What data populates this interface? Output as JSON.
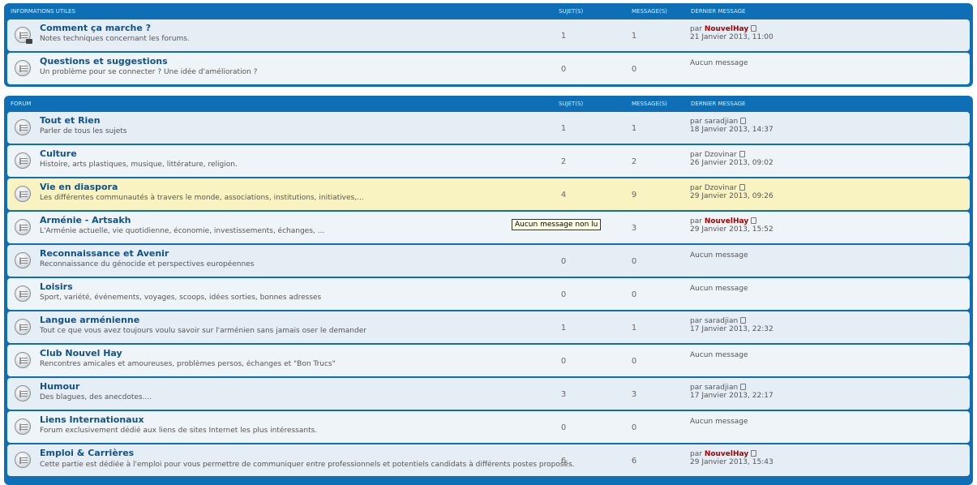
{
  "sections": [
    {
      "header": {
        "name": "INFORMATIONS UTILES",
        "topics": "SUJET(S)",
        "posts": "MESSAGE(S)",
        "last": "DERNIER MESSAGE"
      },
      "forums": [
        {
          "title": "Comment ça marche ?",
          "desc": "Notes techniques concernant les forums.",
          "topics": "1",
          "posts": "1",
          "by_prefix": "par",
          "author": "NouvelHay",
          "date": "21 Janvier 2013, 11:00",
          "icon": "forum-read-locked-icon"
        },
        {
          "title": "Questions et suggestions",
          "desc": "Un problème pour se connecter ? Une idée d'amélioration ?",
          "topics": "0",
          "posts": "0",
          "none": "Aucun message",
          "icon": "forum-read-icon"
        }
      ]
    },
    {
      "header": {
        "name": "FORUM",
        "topics": "SUJET(S)",
        "posts": "MESSAGE(S)",
        "last": "DERNIER MESSAGE"
      },
      "forums": [
        {
          "title": "Tout et Rien",
          "desc": "Parler de tous les sujets",
          "topics": "1",
          "posts": "1",
          "by_prefix": "par",
          "author": "saradjian",
          "date": "18 Janvier 2013, 14:37"
        },
        {
          "title": "Culture",
          "desc": "Histoire, arts plastiques, musique, littérature, religion.",
          "topics": "2",
          "posts": "2",
          "by_prefix": "par",
          "author": "Dzovinar",
          "date": "26 Janvier 2013, 09:02"
        },
        {
          "title": "Vie en diaspora",
          "desc": "Les différentes communautés à travers le monde, associations, institutions, initiatives,...",
          "topics": "4",
          "posts": "9",
          "by_prefix": "par",
          "author": "Dzovinar",
          "date": "29 Janvier 2013, 09:26"
        },
        {
          "title": "Arménie - Artsakh",
          "desc": "L'Arménie actuelle, vie quotidienne, économie, investissements, échanges, ...",
          "topics": "",
          "posts": "3",
          "by_prefix": "par",
          "author": "NouvelHay",
          "date": "29 Janvier 2013, 15:52"
        },
        {
          "title": "Reconnaissance et Avenir",
          "desc": "Reconnaissance du génocide et perspectives européennes",
          "topics": "0",
          "posts": "0",
          "none": "Aucun message"
        },
        {
          "title": "Loisirs",
          "desc": "Sport, variété, événements, voyages, scoops, idées sorties, bonnes adresses",
          "topics": "0",
          "posts": "0",
          "none": "Aucun message"
        },
        {
          "title": "Langue arménienne",
          "desc": "Tout ce que vous avez toujours voulu savoir sur l'arménien sans jamais oser le demander",
          "topics": "1",
          "posts": "1",
          "by_prefix": "par",
          "author": "saradjian",
          "date": "17 Janvier 2013, 22:32"
        },
        {
          "title": "Club Nouvel Hay",
          "desc": "Rencontres amicales et amoureuses, problèmes persos, échanges et \"Bon Trucs\"",
          "topics": "0",
          "posts": "0",
          "none": "Aucun message"
        },
        {
          "title": "Humour",
          "desc": "Des blagues, des anecdotes....",
          "topics": "3",
          "posts": "3",
          "by_prefix": "par",
          "author": "saradjian",
          "date": "17 Janvier 2013, 22:17"
        },
        {
          "title": "Liens Internationaux",
          "desc": "Forum exclusivement dédié aux liens de sites Internet les plus intéressants.",
          "topics": "0",
          "posts": "0",
          "none": "Aucun message"
        },
        {
          "title": "Emploi & Carrières",
          "desc": "Cette partie est dédiée à l'emploi pour vous permettre de communiquer entre professionnels et potentiels candidats à différents postes proposés.",
          "topics": "6",
          "posts": "6",
          "by_prefix": "par",
          "author": "NouvelHay",
          "date": "29 Janvier 2013, 15:43"
        }
      ]
    }
  ],
  "tooltip": "Aucun message non lu",
  "colors": {
    "header_bg": "#0f6fb6",
    "title": "#105289",
    "author_highlight": "#aa0000",
    "row_highlight": "#f9f3c2"
  }
}
